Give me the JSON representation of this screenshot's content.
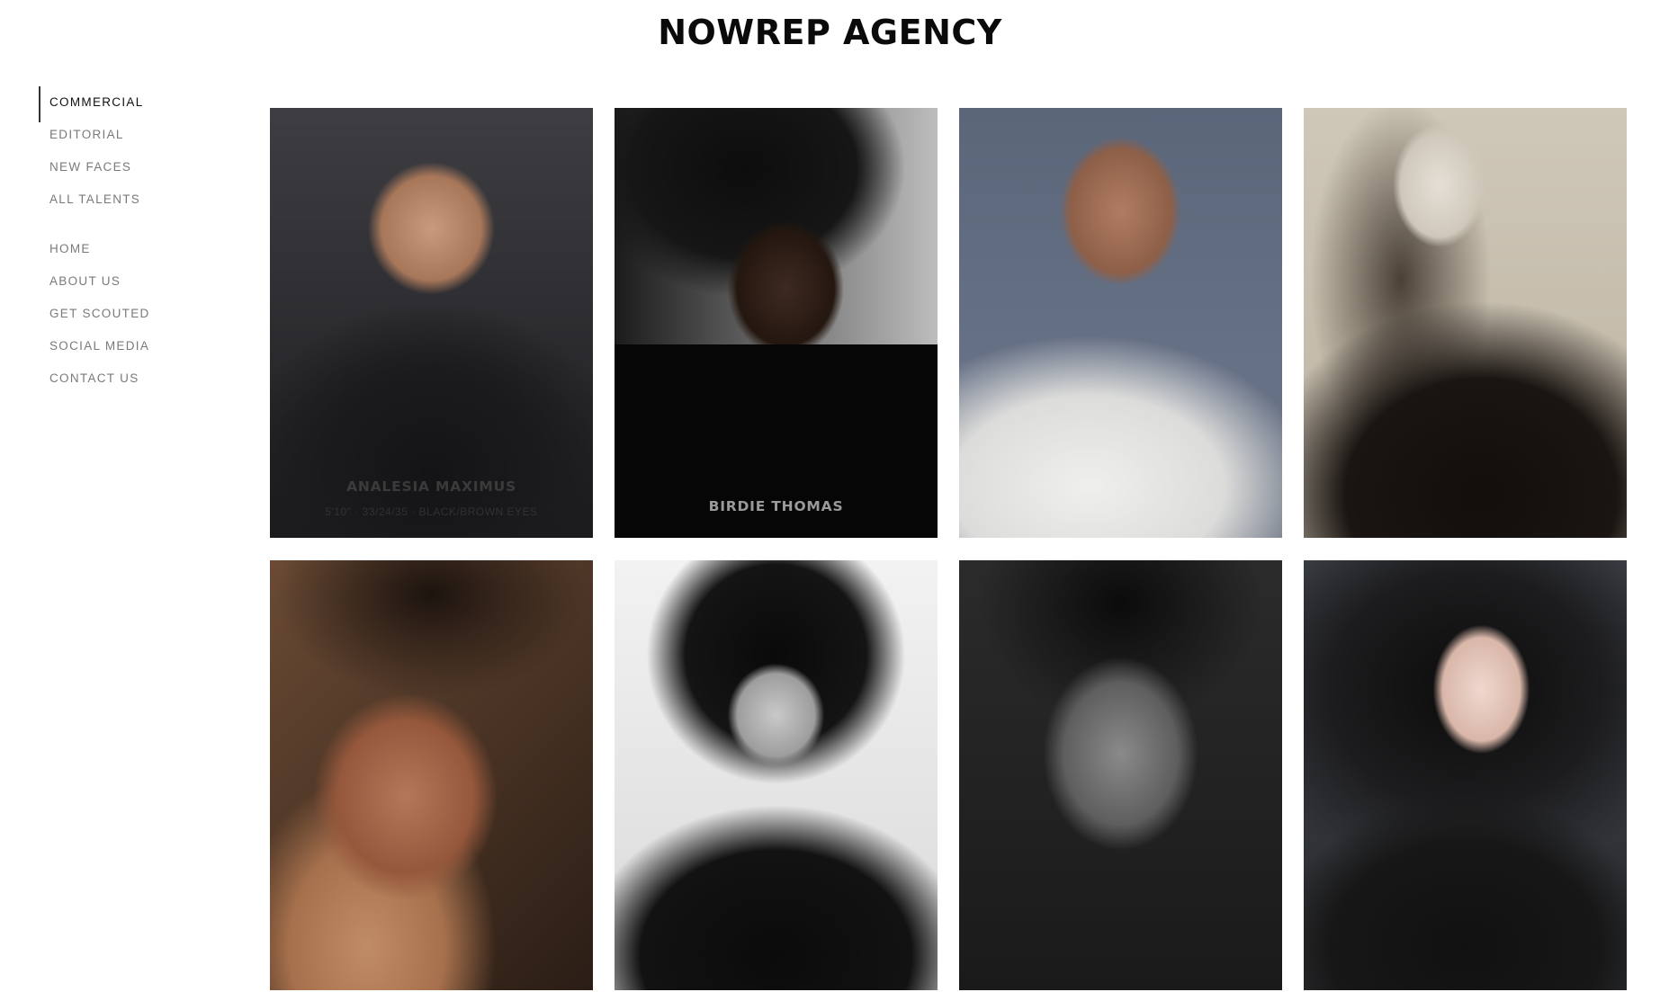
{
  "header": {
    "title": "NOWREP AGENCY"
  },
  "sidebar": {
    "primary": [
      {
        "label": "COMMERCIAL",
        "active": true
      },
      {
        "label": "EDITORIAL"
      },
      {
        "label": "NEW FACES"
      },
      {
        "label": "ALL TALENTS"
      }
    ],
    "secondary": [
      {
        "label": "HOME"
      },
      {
        "label": "ABOUT US"
      },
      {
        "label": "GET SCOUTED"
      },
      {
        "label": "SOCIAL MEDIA"
      },
      {
        "label": "CONTACT US"
      }
    ]
  },
  "grid": {
    "cards": [
      {
        "caption": "ANALESIA MAXIMUS",
        "sub": "5'10\" · 33/24/35 · BLACK/BROWN EYES"
      },
      {
        "caption": "BIRDIE THOMAS"
      },
      {
        "caption": ""
      },
      {
        "caption": ""
      },
      {
        "caption": ""
      },
      {
        "caption": ""
      },
      {
        "caption": ""
      },
      {
        "caption": ""
      }
    ]
  }
}
